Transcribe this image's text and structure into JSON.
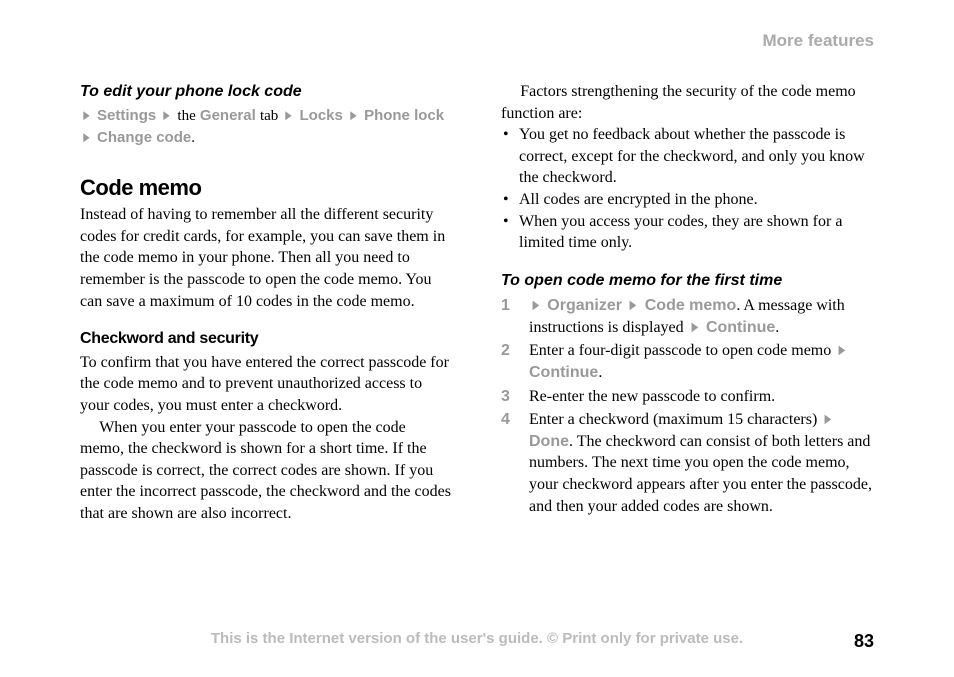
{
  "header": "More features",
  "col1": {
    "h1": "To edit your phone lock code",
    "nav": {
      "a1": "Settings",
      "t1": "the",
      "a2": "General",
      "t2": "tab",
      "a3": "Locks",
      "a4": "Phone lock",
      "a5": "Change code"
    },
    "h2": "Code memo",
    "p1": "Instead of having to remember all the different security codes for credit cards, for example, you can save them in the code memo in your phone. Then all you need to remember is the passcode to open the code memo. You can save a maximum of 10 codes in the code memo.",
    "h3": "Checkword and security",
    "p2": "To confirm that you have entered the correct passcode for the code memo and to prevent unauthorized access to your codes, you must enter a checkword.",
    "p3": "When you enter your passcode to open the code memo, the checkword is shown for a short time. If the passcode is correct, the correct codes are shown. If you enter the incorrect passcode, the checkword and the codes that are shown are also incorrect."
  },
  "col2": {
    "p1": "Factors strengthening the security of the code memo function are:",
    "bullets": [
      "You get no feedback about whether the passcode is correct, except for the checkword, and only you know the checkword.",
      "All codes are encrypted in the phone.",
      "When you access your codes, they are shown for a limited time only."
    ],
    "h1": "To open code memo for the first time",
    "steps": {
      "s1a": "Organizer",
      "s1b": "Code memo",
      "s1c": ". A message with instructions is displayed ",
      "s1d": "Continue",
      "s2a": "Enter a four-digit passcode to open code memo ",
      "s2b": "Continue",
      "s3": "Re-enter the new passcode to confirm.",
      "s4a": "Enter a checkword (maximum 15 characters) ",
      "s4b": "Done",
      "s4c": ". The checkword can consist of both letters and numbers. The next time you open the code memo, your checkword appears after you enter the passcode, and then your added codes are shown."
    }
  },
  "footer": "This is the Internet version of the user's guide. © Print only for private use.",
  "pageNum": "83"
}
